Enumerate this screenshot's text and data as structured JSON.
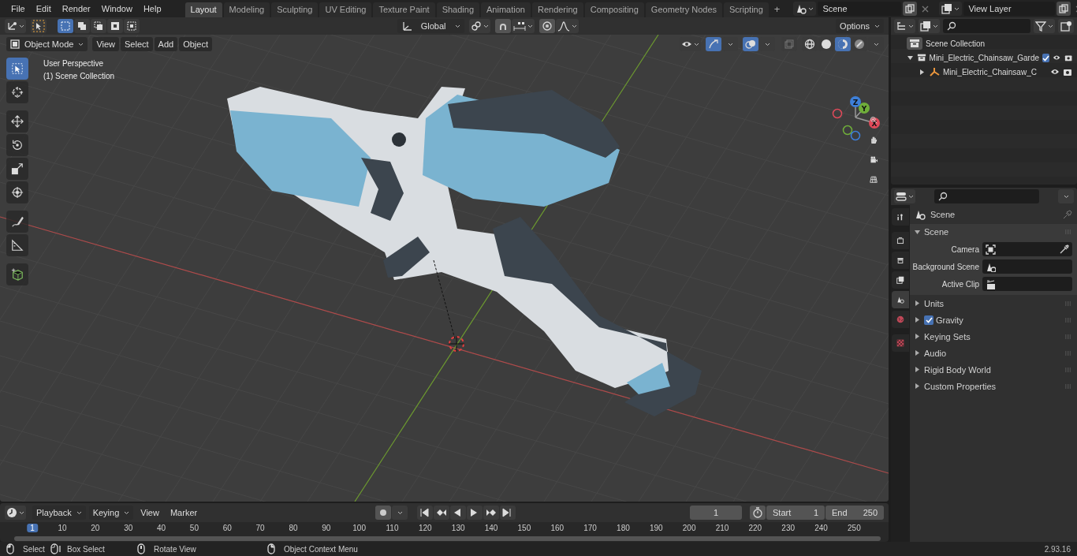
{
  "top_bar": {
    "menus": [
      "File",
      "Edit",
      "Render",
      "Window",
      "Help"
    ],
    "workspaces": [
      {
        "label": "Layout",
        "selected": true
      },
      {
        "label": "Modeling",
        "selected": false
      },
      {
        "label": "Sculpting",
        "selected": false
      },
      {
        "label": "UV Editing",
        "selected": false
      },
      {
        "label": "Texture Paint",
        "selected": false
      },
      {
        "label": "Shading",
        "selected": false
      },
      {
        "label": "Animation",
        "selected": false
      },
      {
        "label": "Rendering",
        "selected": false
      },
      {
        "label": "Compositing",
        "selected": false
      },
      {
        "label": "Geometry Nodes",
        "selected": false
      },
      {
        "label": "Scripting",
        "selected": false
      }
    ],
    "add_workspace": "+",
    "scene": "Scene",
    "view_layer": "View Layer"
  },
  "viewport": {
    "selection_modes": [
      {
        "selected": true
      },
      {
        "selected": false
      },
      {
        "selected": false
      },
      {
        "selected": false
      },
      {
        "selected": false
      }
    ],
    "transform_orientation": "Global",
    "options": "Options",
    "mode": "Object Mode",
    "menus": [
      "View",
      "Select",
      "Add",
      "Object"
    ],
    "show_gizmos": true,
    "show_overlays": true,
    "shading": [
      {
        "kind": "wireframe",
        "selected": false
      },
      {
        "kind": "solid",
        "selected": false
      },
      {
        "kind": "material",
        "selected": true
      },
      {
        "kind": "rendered",
        "selected": false
      }
    ],
    "overlay_text": [
      "User Perspective",
      "(1) Scene Collection"
    ],
    "tools": [
      {
        "kind": "select",
        "selected": true
      },
      {
        "kind": "cursor",
        "selected": false
      },
      {
        "kind": "move",
        "selected": false
      },
      {
        "kind": "rotate",
        "selected": false
      },
      {
        "kind": "scale",
        "selected": false
      },
      {
        "kind": "transform",
        "selected": false
      },
      {
        "kind": "annotate",
        "selected": false
      },
      {
        "kind": "measure",
        "selected": false
      },
      {
        "kind": "add_cube",
        "selected": false
      }
    ],
    "gizmo_axes": [
      "X",
      "Y",
      "Z"
    ]
  },
  "outliner": {
    "root": "Scene Collection",
    "items": [
      {
        "name": "Mini_Electric_Chainsaw_Garde",
        "kind": "collection",
        "expanded": true,
        "checked": true,
        "children": [
          {
            "name": "Mini_Electric_Chainsaw_C",
            "kind": "empty",
            "expanded": false
          }
        ]
      }
    ]
  },
  "properties": {
    "tabs": [
      {
        "kind": "tool",
        "selected": false
      },
      {
        "kind": "render",
        "selected": false
      },
      {
        "kind": "output",
        "selected": false
      },
      {
        "kind": "view_layer",
        "selected": false
      },
      {
        "kind": "scene",
        "selected": true
      },
      {
        "kind": "world",
        "selected": false
      },
      {
        "kind": "texture",
        "selected": false
      }
    ],
    "context": "Scene",
    "panel": {
      "title": "Scene",
      "expanded": true,
      "fields": [
        {
          "label": "Camera",
          "kind": "camera"
        },
        {
          "label": "Background Scene",
          "kind": "scene"
        },
        {
          "label": "Active Clip",
          "kind": "clip"
        }
      ]
    },
    "subpanels": [
      {
        "title": "Units",
        "expanded": false
      },
      {
        "title": "Gravity",
        "expanded": false,
        "checked": true
      },
      {
        "title": "Keying Sets",
        "expanded": false
      },
      {
        "title": "Audio",
        "expanded": false
      },
      {
        "title": "Rigid Body World",
        "expanded": false
      },
      {
        "title": "Custom Properties",
        "expanded": false
      }
    ]
  },
  "timeline": {
    "menus": [
      {
        "label": "Playback",
        "dropdown": true
      },
      {
        "label": "Keying",
        "dropdown": true
      },
      {
        "label": "View",
        "dropdown": false
      },
      {
        "label": "Marker",
        "dropdown": false
      }
    ],
    "auto_keying": false,
    "current_frame": "1",
    "start_label": "Start",
    "start": "1",
    "end_label": "End",
    "end": "250",
    "ruler": [
      {
        "label": "1",
        "selected": true
      },
      {
        "label": "10",
        "selected": false
      },
      {
        "label": "20",
        "selected": false
      },
      {
        "label": "30",
        "selected": false
      },
      {
        "label": "40",
        "selected": false
      },
      {
        "label": "50",
        "selected": false
      },
      {
        "label": "60",
        "selected": false
      },
      {
        "label": "70",
        "selected": false
      },
      {
        "label": "80",
        "selected": false
      },
      {
        "label": "90",
        "selected": false
      },
      {
        "label": "100",
        "selected": false
      },
      {
        "label": "110",
        "selected": false
      },
      {
        "label": "120",
        "selected": false
      },
      {
        "label": "130",
        "selected": false
      },
      {
        "label": "140",
        "selected": false
      },
      {
        "label": "150",
        "selected": false
      },
      {
        "label": "160",
        "selected": false
      },
      {
        "label": "170",
        "selected": false
      },
      {
        "label": "180",
        "selected": false
      },
      {
        "label": "190",
        "selected": false
      },
      {
        "label": "200",
        "selected": false
      },
      {
        "label": "210",
        "selected": false
      },
      {
        "label": "220",
        "selected": false
      },
      {
        "label": "230",
        "selected": false
      },
      {
        "label": "240",
        "selected": false
      },
      {
        "label": "250",
        "selected": false
      }
    ]
  },
  "status_bar": {
    "hints": [
      {
        "kind": "mouse_left",
        "label": "Select"
      },
      {
        "kind": "mouse_drag",
        "label": "Box Select"
      },
      {
        "kind": "mouse_middle",
        "label": "Rotate View"
      },
      {
        "kind": "mouse_right",
        "label": "Object Context Menu"
      }
    ],
    "version": "2.93.16"
  }
}
